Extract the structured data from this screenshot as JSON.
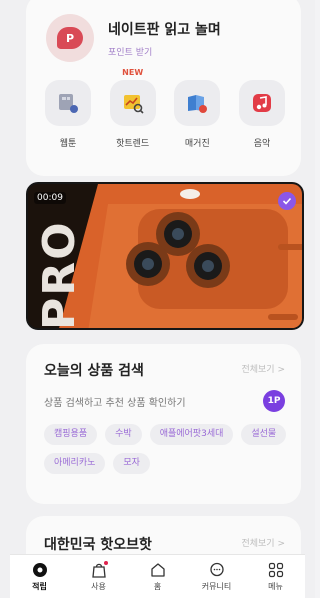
{
  "promo": {
    "title": "네이트판 읽고 놀며",
    "subtitle": "포인트 받기",
    "logo_letter": "P"
  },
  "shortcuts": [
    {
      "label": "웹툰",
      "icon": "webtoon-icon"
    },
    {
      "label": "핫트렌드",
      "icon": "hot-trend-icon",
      "badge": "NEW"
    },
    {
      "label": "매거진",
      "icon": "magazine-icon"
    },
    {
      "label": "음악",
      "icon": "music-icon"
    }
  ],
  "video": {
    "time": "00:09",
    "brand_text": "PRO"
  },
  "search": {
    "title": "오늘의 상품 검색",
    "view_all": "전체보기 >",
    "subtitle": "상품 검색하고 추천 상품 확인하기",
    "rank_badge": "1P",
    "tags": [
      "캠핑용품",
      "수박",
      "애플에어팟3세대",
      "설선물",
      "아메리카노",
      "모자"
    ]
  },
  "next_section": {
    "title": "대한민국 핫오브핫",
    "view_all": "전체보기 >"
  },
  "bottom_nav": [
    {
      "label": "적립",
      "icon": "point-icon",
      "active": true
    },
    {
      "label": "사용",
      "icon": "shopping-bag-icon",
      "dot": true
    },
    {
      "label": "홈",
      "icon": "home-icon"
    },
    {
      "label": "커뮤니티",
      "icon": "chat-icon"
    },
    {
      "label": "메뉴",
      "icon": "menu-grid-icon"
    }
  ],
  "colors": {
    "accent_purple": "#7a3fe0",
    "tag_text": "#9a6bd6",
    "new_badge": "#e0523d",
    "video_orange": "#d9622a"
  }
}
